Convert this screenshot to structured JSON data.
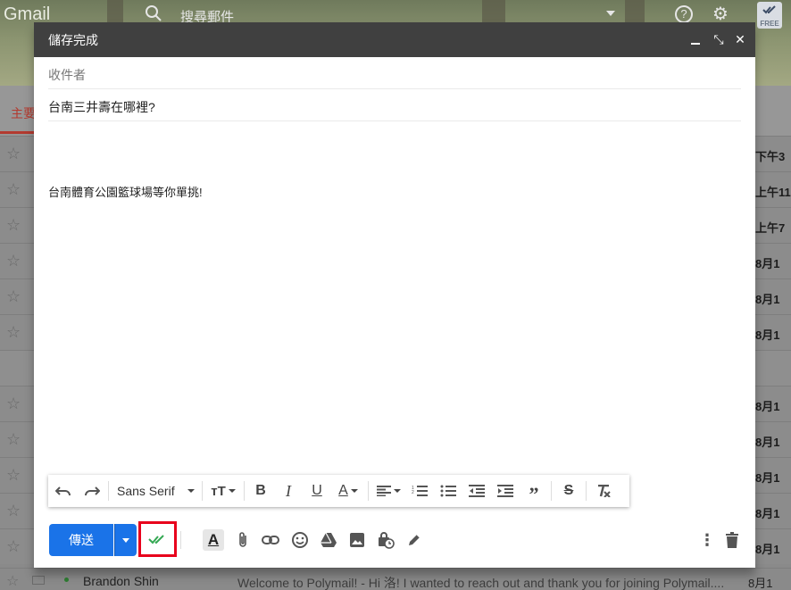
{
  "background": {
    "logo": "Gmail",
    "search_placeholder": "搜尋郵件",
    "free_badge": "FREE",
    "active_tab_label": "主要",
    "row_dates": [
      "下午3",
      "上午11",
      "上午7",
      "8月1",
      "8月1",
      "8月1",
      "",
      "8月1",
      "8月1",
      "8月1",
      "8月1",
      "8月1"
    ],
    "last_row": {
      "sender": "Brandon Shin",
      "snippet": "Welcome to Polymail! - Hi 洛! I wanted to reach out and thank you for joining Polymail....",
      "date": "8月1"
    }
  },
  "compose": {
    "title": "儲存完成",
    "to_placeholder": "收件者",
    "subject": "台南三井壽在哪裡?",
    "body": "台南體育公園籃球場等你單挑!",
    "font_name": "Sans Serif",
    "send_label": "傳送"
  },
  "colors": {
    "send_blue": "#1a73e8",
    "highlight_red": "#e8001c",
    "title_bar": "#404040",
    "polymail_check": "#34a853"
  }
}
